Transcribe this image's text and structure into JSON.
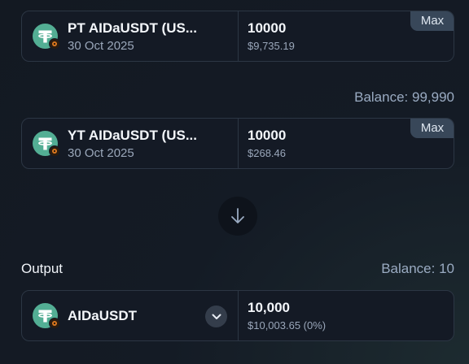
{
  "input_pt": {
    "token_name": "PT AIDaUSDT (US...",
    "date": "30 Oct 2025",
    "amount": "10000",
    "usd_value": "$9,735.19",
    "max_label": "Max"
  },
  "balance_between": "Balance: 99,990",
  "input_yt": {
    "token_name": "YT AIDaUSDT (US...",
    "date": "30 Oct 2025",
    "amount": "10000",
    "usd_value": "$268.46",
    "max_label": "Max"
  },
  "swap_direction_icon": "arrow-down-icon",
  "output": {
    "label": "Output",
    "balance": "Balance: 10",
    "token_name": "AIDaUSDT",
    "amount": "10,000",
    "usd_value": "$10,003.65 (0%)"
  },
  "colors": {
    "background": "#141b25",
    "card_border": "#2c3644",
    "token_icon": "#53ae94",
    "max_button": "#384759",
    "muted_text": "#9aa7ba"
  }
}
